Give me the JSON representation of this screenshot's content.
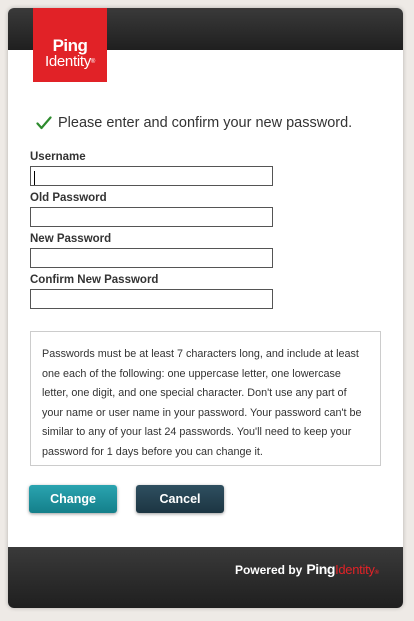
{
  "brand": {
    "logo_ping": "Ping",
    "logo_identity": "Identity",
    "logo_tm": "®",
    "color": "#e12227"
  },
  "message": {
    "icon": "checkmark-icon",
    "text": "Please enter and confirm your new password."
  },
  "form": {
    "username_label": "Username",
    "username_value": "",
    "old_password_label": "Old Password",
    "old_password_value": "",
    "new_password_label": "New Password",
    "new_password_value": "",
    "confirm_password_label": "Confirm New Password",
    "confirm_password_value": ""
  },
  "policy_text": "Passwords must be at least 7 characters long, and include at least one each of the following: one uppercase letter, one lowercase letter, one digit, and one special character. Don't use any part of your name or user name in your password. Your password can't be similar to any of your last 24 passwords. You'll need to keep your password for 1 days before you can change it.",
  "buttons": {
    "change_label": "Change",
    "cancel_label": "Cancel",
    "change_color": "#1f95a1",
    "cancel_color": "#264453"
  },
  "footer": {
    "powered_by": "Powered by",
    "ping": "Ping",
    "identity": "Identity",
    "tm": "®"
  }
}
